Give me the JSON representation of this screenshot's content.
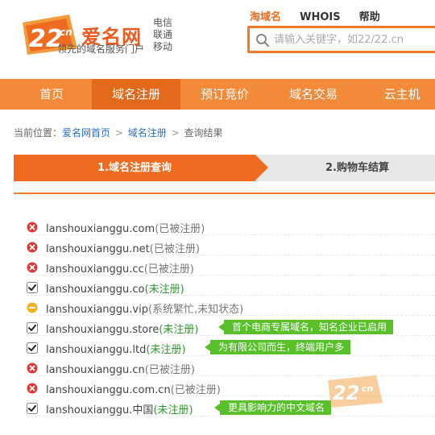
{
  "brand": {
    "name": "爱名网",
    "tagline": "领先的域名服务门户",
    "carriers": [
      "电信",
      "联通",
      "移动"
    ],
    "logo_mark_text": "22",
    "logo_mark_suffix": "cn",
    "accent": "#ef6b1f"
  },
  "topnav": {
    "items": [
      {
        "label": "淘域名",
        "active": true
      },
      {
        "label": "WHOIS",
        "active": false
      },
      {
        "label": "帮助",
        "active": false
      }
    ]
  },
  "search": {
    "placeholder": "请输入关键字，如22/22.cn",
    "icon": "search-icon"
  },
  "mainnav": {
    "items": [
      {
        "label": "首页",
        "active": false
      },
      {
        "label": "域名注册",
        "active": true
      },
      {
        "label": "预订竞价",
        "active": false
      },
      {
        "label": "域名交易",
        "active": false
      },
      {
        "label": "云主机",
        "active": false
      }
    ]
  },
  "breadcrumb": {
    "prefix": "当前位置：",
    "links": [
      "爱名网首页",
      "域名注册"
    ],
    "current": "查询结果",
    "separator": ">"
  },
  "steps": {
    "step1": "1.域名注册查询",
    "step2": "2.购物车结算"
  },
  "results": [
    {
      "domain": "lanshouxianggu.com",
      "state": "(已被注册)",
      "status": "taken",
      "promo": ""
    },
    {
      "domain": "lanshouxianggu.net",
      "state": "(已被注册)",
      "status": "taken",
      "promo": ""
    },
    {
      "domain": "lanshouxianggu.cc",
      "state": "(已被注册)",
      "status": "taken",
      "promo": ""
    },
    {
      "domain": "lanshouxianggu.co",
      "state": "(未注册)",
      "status": "available",
      "promo": ""
    },
    {
      "domain": "lanshouxianggu.vip",
      "state": "(系统繁忙,未知状态)",
      "status": "unknown",
      "promo": ""
    },
    {
      "domain": "lanshouxianggu.store",
      "state": "(未注册)",
      "status": "available",
      "promo": "首个电商专属域名，知名企业已启用"
    },
    {
      "domain": "lanshouxianggu.ltd",
      "state": "(未注册)",
      "status": "available",
      "promo": "为有限公司而生，终端用户多"
    },
    {
      "domain": "lanshouxianggu.cn",
      "state": "(已被注册)",
      "status": "taken",
      "promo": ""
    },
    {
      "domain": "lanshouxianggu.com.cn",
      "state": "(已被注册)",
      "status": "taken",
      "promo": ""
    },
    {
      "domain": "lanshouxianggu.中国",
      "state": "(未注册)",
      "status": "available",
      "promo": "更具影响力的中文域名"
    }
  ],
  "colors": {
    "nav_bg": "#f38a3a",
    "nav_active": "#e26a1a",
    "taken": "#d93a3a",
    "unknown": "#f0b21c",
    "available_text": "#2a9a2a",
    "promo_bg": "#58c12a",
    "link": "#2a6ec6"
  }
}
